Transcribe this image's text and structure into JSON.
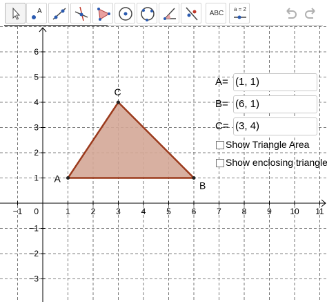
{
  "toolbar": {
    "tools": [
      {
        "name": "move-tool",
        "icon": "arrow-cursor-icon"
      },
      {
        "name": "point-tool",
        "icon": "point-icon"
      },
      {
        "name": "line-tool",
        "icon": "line-icon"
      },
      {
        "name": "perpendicular-line-tool",
        "icon": "perpendicular-line-icon"
      },
      {
        "name": "polygon-tool",
        "icon": "polygon-icon"
      },
      {
        "name": "circle-center-point-tool",
        "icon": "circle-icon"
      },
      {
        "name": "circle-three-points-tool",
        "icon": "circle-three-points-icon"
      },
      {
        "name": "angle-tool",
        "icon": "angle-icon"
      },
      {
        "name": "reflect-tool",
        "icon": "reflect-icon"
      },
      {
        "name": "text-tool",
        "icon": "text-icon",
        "label": "ABC"
      },
      {
        "name": "slider-tool",
        "icon": "slider-icon",
        "label": "a = 2"
      }
    ],
    "undo_icon": "undo-icon",
    "redo_icon": "redo-icon"
  },
  "graph": {
    "x_axis_labels": [
      "-1",
      "1",
      "2",
      "3",
      "4",
      "5",
      "6",
      "7",
      "8",
      "9",
      "10",
      "11"
    ],
    "y_axis_labels": [
      "6",
      "5",
      "4",
      "3",
      "2",
      "1",
      "-1",
      "-2",
      "-3"
    ],
    "origin_label": "0",
    "grid": "dashed",
    "triangle": {
      "points": [
        {
          "name": "A",
          "x": 1,
          "y": 1
        },
        {
          "name": "B",
          "x": 6,
          "y": 1
        },
        {
          "name": "C",
          "x": 3,
          "y": 4
        }
      ],
      "fill_color": "#d4a797",
      "stroke_color": "#9b3a1c"
    }
  },
  "inputs": {
    "a_label": "A=",
    "a_value": "(1, 1)",
    "b_label": "B=",
    "b_value": "(6, 1)",
    "c_label": "C=",
    "c_value": "(3, 4)"
  },
  "checkboxes": {
    "show_area_label": "Show Triangle Area",
    "show_enclosing_label": "Show enclosing triangle"
  }
}
